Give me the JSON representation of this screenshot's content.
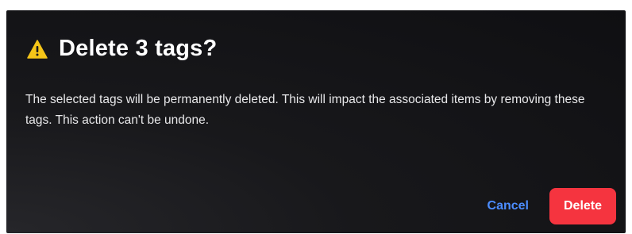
{
  "dialog": {
    "icon": "warning-triangle-icon",
    "title": "Delete 3 tags?",
    "message": "The selected tags will be permanently deleted. This will impact the associated items by removing these tags. This action can't be undone.",
    "cancel_label": "Cancel",
    "delete_label": "Delete"
  },
  "colors": {
    "background": "#121215",
    "warning": "#f5c518",
    "link": "#4c8dff",
    "danger": "#f5343f"
  }
}
